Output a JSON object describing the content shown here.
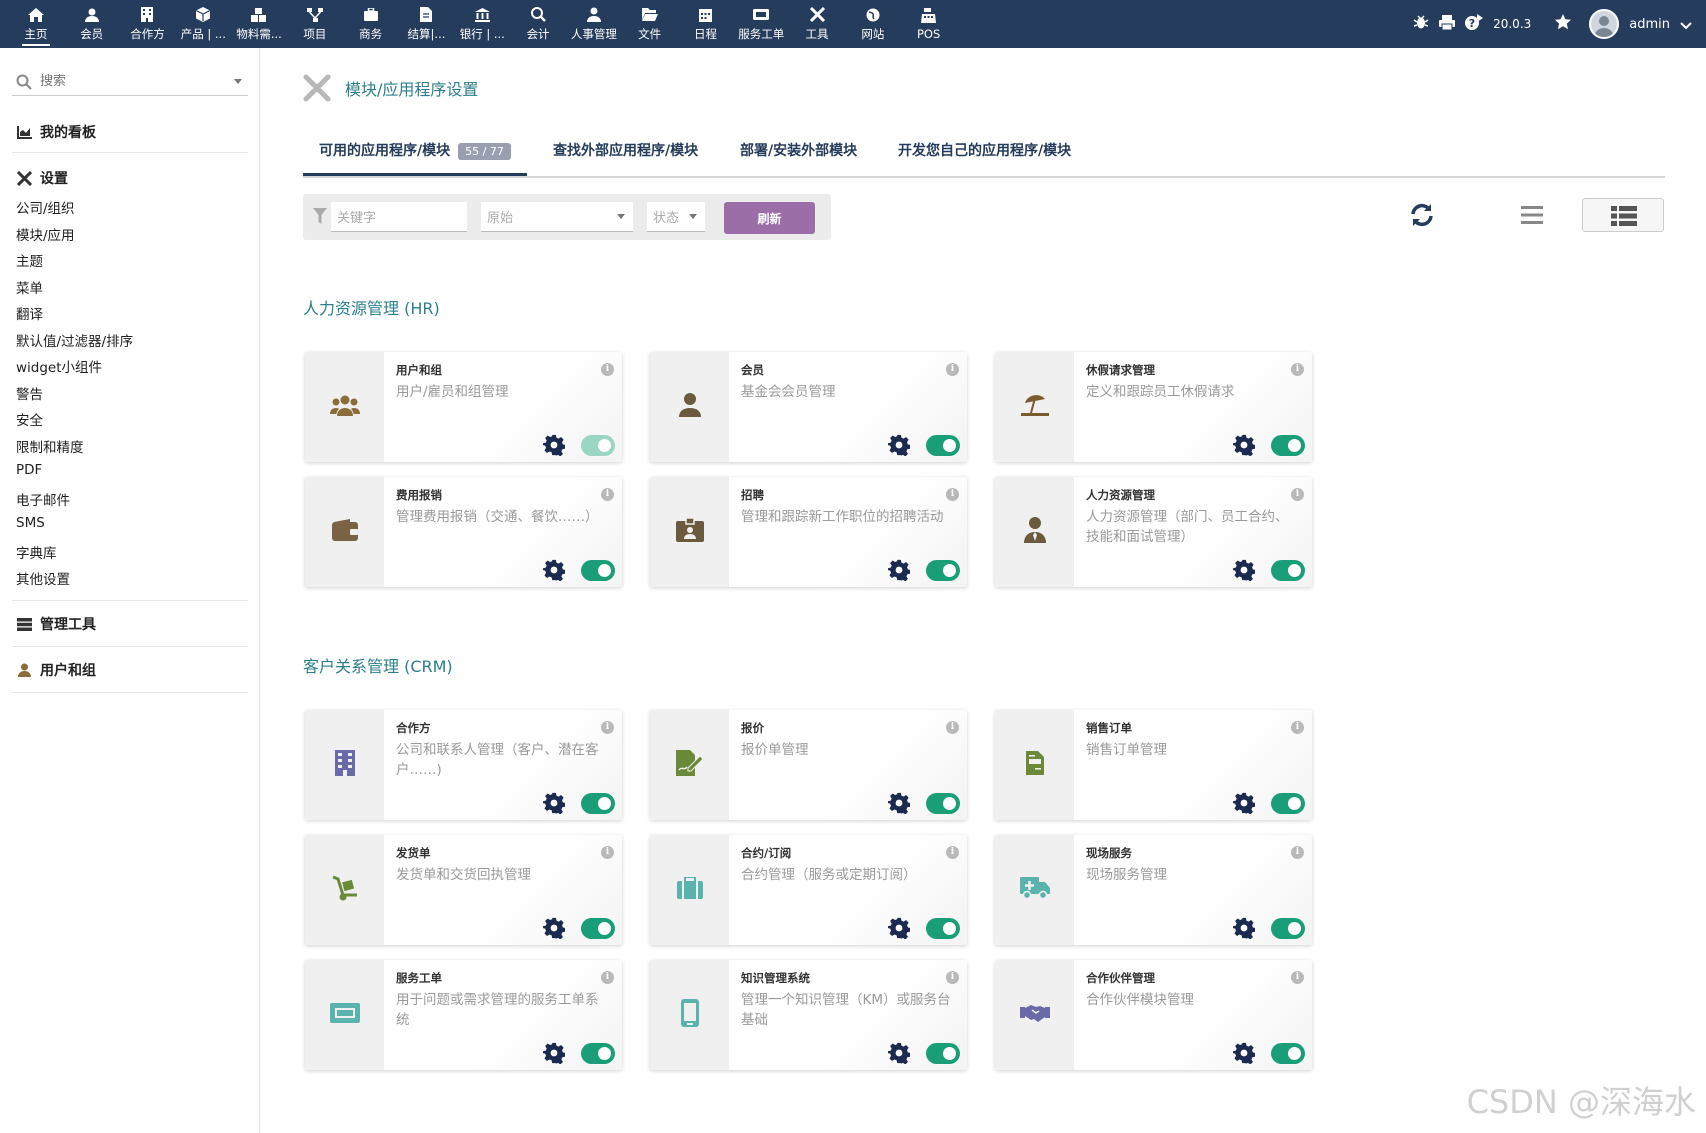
{
  "topbar": {
    "nav": [
      {
        "label": "主页",
        "icon": "home-icon"
      },
      {
        "label": "会员",
        "icon": "user-icon"
      },
      {
        "label": "合作方",
        "icon": "building-icon"
      },
      {
        "label": "产品 | ...",
        "icon": "cube-icon"
      },
      {
        "label": "物料需...",
        "icon": "cubes-icon"
      },
      {
        "label": "项目",
        "icon": "sitemap-icon"
      },
      {
        "label": "商务",
        "icon": "briefcase-icon"
      },
      {
        "label": "结算|...",
        "icon": "invoice-icon"
      },
      {
        "label": "银行 | ...",
        "icon": "bank-icon"
      },
      {
        "label": "会计",
        "icon": "search-dollar-icon"
      },
      {
        "label": "人事管理",
        "icon": "user-tie-icon"
      },
      {
        "label": "文件",
        "icon": "folder-open-icon"
      },
      {
        "label": "日程",
        "icon": "calendar-icon"
      },
      {
        "label": "服务工单",
        "icon": "ticket-icon"
      },
      {
        "label": "工具",
        "icon": "tools-icon"
      },
      {
        "label": "网站",
        "icon": "globe-icon"
      },
      {
        "label": "POS",
        "icon": "cash-register-icon"
      }
    ],
    "version": "20.0.3",
    "username": "admin"
  },
  "sidebar": {
    "search_placeholder": "搜索",
    "dashboard": "我的看板",
    "settings": "设置",
    "settings_items": [
      "公司/组织",
      "模块/应用",
      "主题",
      "菜单",
      "翻译",
      "默认值/过滤器/排序",
      "widget小组件",
      "警告",
      "安全",
      "限制和精度",
      "PDF",
      "电子邮件",
      "SMS",
      "字典库",
      "其他设置"
    ],
    "admin_tools": "管理工具",
    "users_groups": "用户和组"
  },
  "page": {
    "title": "模块/应用程序设置",
    "tabs": [
      {
        "label": "可用的应用程序/模块",
        "badge": "55 / 77"
      },
      {
        "label": "查找外部应用程序/模块"
      },
      {
        "label": "部署/安装外部模块"
      },
      {
        "label": "开发您自己的应用程序/模块"
      }
    ],
    "filter": {
      "keyword_placeholder": "关键字",
      "origin_placeholder": "原始",
      "status_placeholder": "状态",
      "refresh_label": "刷新"
    }
  },
  "groups": [
    {
      "title": "人力资源管理 (HR)",
      "cards": [
        {
          "title": "用户和组",
          "desc": "用户/雇员和组管理",
          "icon": "users-icon",
          "color": "#8a6d3b",
          "enabled": true,
          "locked": true
        },
        {
          "title": "会员",
          "desc": "基金会会员管理",
          "icon": "member-icon",
          "color": "#6b5a3e",
          "enabled": true
        },
        {
          "title": "休假请求管理",
          "desc": "定义和跟踪员工休假请求",
          "icon": "umbrella-beach-icon",
          "color": "#7a5a2e",
          "enabled": true
        },
        {
          "title": "费用报销",
          "desc": "管理费用报销（交通、餐饮……）",
          "icon": "wallet-icon",
          "color": "#7a6244",
          "enabled": true
        },
        {
          "title": "招聘",
          "desc": "管理和跟踪新工作职位的招聘活动",
          "icon": "id-badge-icon",
          "color": "#6b5a3e",
          "enabled": true
        },
        {
          "title": "人力资源管理",
          "desc": "人力资源管理（部门、员工合约、技能和面试管理）",
          "icon": "user-tie-icon",
          "color": "#6b5a3e",
          "enabled": true
        }
      ]
    },
    {
      "title": "客户关系管理 (CRM)",
      "cards": [
        {
          "title": "合作方",
          "desc": "公司和联系人管理（客户、潜在客户……)",
          "icon": "building-icon",
          "color": "#6b6aa8",
          "enabled": true
        },
        {
          "title": "报价",
          "desc": "报价单管理",
          "icon": "file-signature-icon",
          "color": "#6a8a3a",
          "enabled": true
        },
        {
          "title": "销售订单",
          "desc": "销售订单管理",
          "icon": "file-invoice-icon",
          "color": "#6a8a3a",
          "enabled": true
        },
        {
          "title": "发货单",
          "desc": "发货单和交货回执管理",
          "icon": "dolly-icon",
          "color": "#6a8a3a",
          "enabled": true
        },
        {
          "title": "合约/订阅",
          "desc": "合约管理（服务或定期订阅）",
          "icon": "suitcase-icon",
          "color": "#5bb3ad",
          "enabled": true
        },
        {
          "title": "现场服务",
          "desc": "现场服务管理",
          "icon": "ambulance-icon",
          "color": "#5bb3ad",
          "enabled": true
        },
        {
          "title": "服务工单",
          "desc": "用于问题或需求管理的服务工单系统",
          "icon": "ticket-icon",
          "color": "#5bb3ad",
          "enabled": true
        },
        {
          "title": "知识管理系统",
          "desc": "管理一个知识管理（KM）或服务台基础",
          "icon": "mobile-icon",
          "color": "#5bb3ad",
          "enabled": true
        },
        {
          "title": "合作伙伴管理",
          "desc": "合作伙伴模块管理",
          "icon": "handshake-icon",
          "color": "#6b6aa8",
          "enabled": true
        }
      ]
    }
  ],
  "watermark": "CSDN @深海水"
}
